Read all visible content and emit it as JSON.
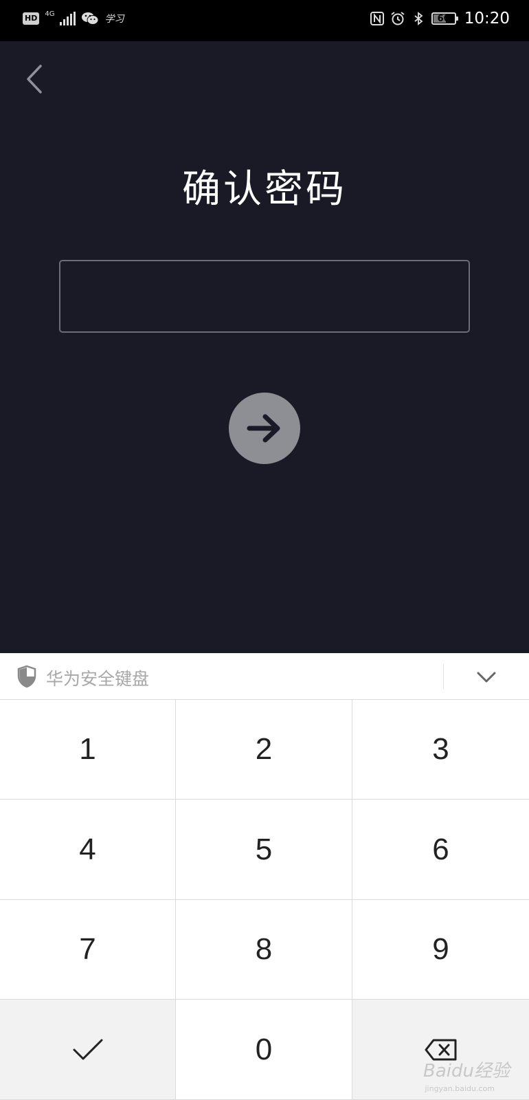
{
  "status_bar": {
    "hd_badge": "HD",
    "network": "4G",
    "app_badge": "学习",
    "battery_level": "60",
    "battery_fraction": 0.6,
    "time": "10:20"
  },
  "header": {
    "back_icon": "chevron-left-icon"
  },
  "main": {
    "title": "确认密码",
    "password_value": "",
    "next_icon": "arrow-right-icon"
  },
  "keyboard": {
    "title": "华为安全键盘",
    "shield_icon": "shield-icon",
    "collapse_icon": "chevron-down-icon",
    "keys": [
      "1",
      "2",
      "3",
      "4",
      "5",
      "6",
      "7",
      "8",
      "9",
      "0"
    ],
    "confirm_icon": "checkmark-icon",
    "delete_icon": "backspace-icon"
  },
  "watermark": {
    "text": "Baidu经验",
    "sub": "jingyan.baidu.com"
  },
  "colors": {
    "background": "#191a26",
    "status_bar": "#000000",
    "button": "#8e8f94",
    "keyboard_bg": "#ffffff",
    "key_gray": "#f2f2f2"
  }
}
